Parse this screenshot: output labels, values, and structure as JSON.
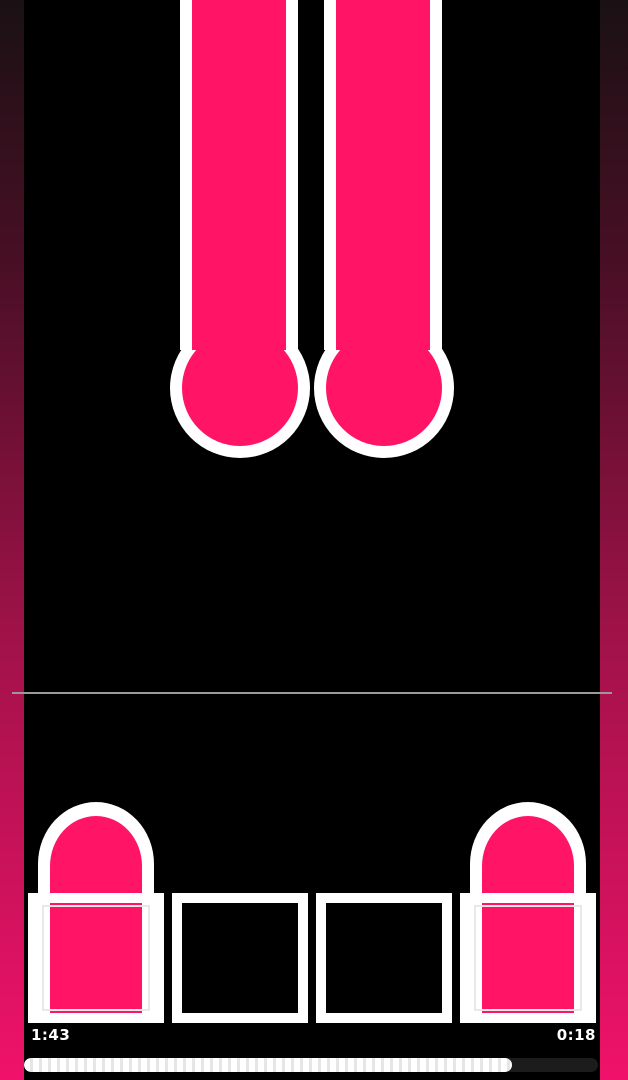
{
  "colors": {
    "accent": "#ff1466",
    "outline": "#ffffff",
    "background": "#000000",
    "hit_line": "#9a9a9a"
  },
  "lanes": [
    {
      "index": 1,
      "key_pressed": true
    },
    {
      "index": 2,
      "key_pressed": false
    },
    {
      "index": 3,
      "key_pressed": false
    },
    {
      "index": 4,
      "key_pressed": true
    }
  ],
  "hud": {
    "time_elapsed": "1:43",
    "time_remaining": "0:18",
    "progress_fraction": 0.85
  }
}
